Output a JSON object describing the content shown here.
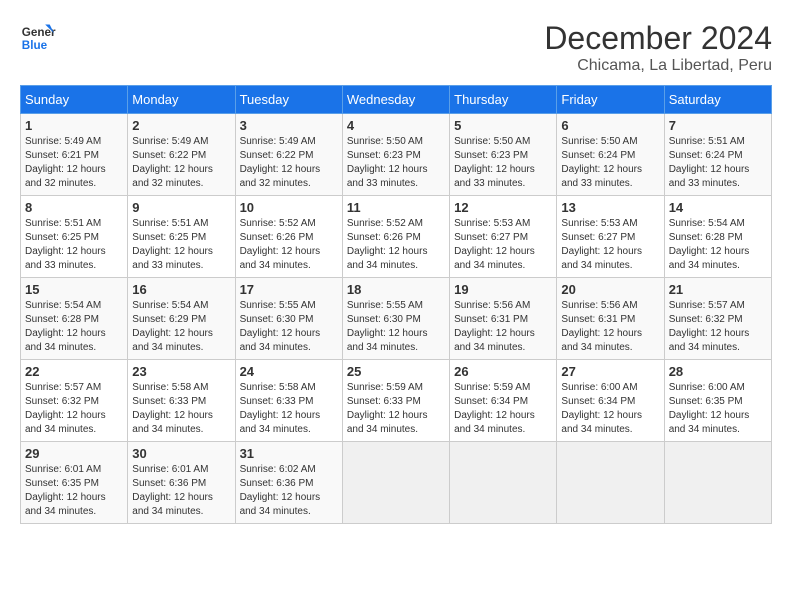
{
  "logo": {
    "line1": "General",
    "line2": "Blue"
  },
  "title": "December 2024",
  "location": "Chicama, La Libertad, Peru",
  "days_header": [
    "Sunday",
    "Monday",
    "Tuesday",
    "Wednesday",
    "Thursday",
    "Friday",
    "Saturday"
  ],
  "weeks": [
    [
      {
        "num": "1",
        "info": "Sunrise: 5:49 AM\nSunset: 6:21 PM\nDaylight: 12 hours\nand 32 minutes."
      },
      {
        "num": "2",
        "info": "Sunrise: 5:49 AM\nSunset: 6:22 PM\nDaylight: 12 hours\nand 32 minutes."
      },
      {
        "num": "3",
        "info": "Sunrise: 5:49 AM\nSunset: 6:22 PM\nDaylight: 12 hours\nand 32 minutes."
      },
      {
        "num": "4",
        "info": "Sunrise: 5:50 AM\nSunset: 6:23 PM\nDaylight: 12 hours\nand 33 minutes."
      },
      {
        "num": "5",
        "info": "Sunrise: 5:50 AM\nSunset: 6:23 PM\nDaylight: 12 hours\nand 33 minutes."
      },
      {
        "num": "6",
        "info": "Sunrise: 5:50 AM\nSunset: 6:24 PM\nDaylight: 12 hours\nand 33 minutes."
      },
      {
        "num": "7",
        "info": "Sunrise: 5:51 AM\nSunset: 6:24 PM\nDaylight: 12 hours\nand 33 minutes."
      }
    ],
    [
      {
        "num": "8",
        "info": "Sunrise: 5:51 AM\nSunset: 6:25 PM\nDaylight: 12 hours\nand 33 minutes."
      },
      {
        "num": "9",
        "info": "Sunrise: 5:51 AM\nSunset: 6:25 PM\nDaylight: 12 hours\nand 33 minutes."
      },
      {
        "num": "10",
        "info": "Sunrise: 5:52 AM\nSunset: 6:26 PM\nDaylight: 12 hours\nand 34 minutes."
      },
      {
        "num": "11",
        "info": "Sunrise: 5:52 AM\nSunset: 6:26 PM\nDaylight: 12 hours\nand 34 minutes."
      },
      {
        "num": "12",
        "info": "Sunrise: 5:53 AM\nSunset: 6:27 PM\nDaylight: 12 hours\nand 34 minutes."
      },
      {
        "num": "13",
        "info": "Sunrise: 5:53 AM\nSunset: 6:27 PM\nDaylight: 12 hours\nand 34 minutes."
      },
      {
        "num": "14",
        "info": "Sunrise: 5:54 AM\nSunset: 6:28 PM\nDaylight: 12 hours\nand 34 minutes."
      }
    ],
    [
      {
        "num": "15",
        "info": "Sunrise: 5:54 AM\nSunset: 6:28 PM\nDaylight: 12 hours\nand 34 minutes."
      },
      {
        "num": "16",
        "info": "Sunrise: 5:54 AM\nSunset: 6:29 PM\nDaylight: 12 hours\nand 34 minutes."
      },
      {
        "num": "17",
        "info": "Sunrise: 5:55 AM\nSunset: 6:30 PM\nDaylight: 12 hours\nand 34 minutes."
      },
      {
        "num": "18",
        "info": "Sunrise: 5:55 AM\nSunset: 6:30 PM\nDaylight: 12 hours\nand 34 minutes."
      },
      {
        "num": "19",
        "info": "Sunrise: 5:56 AM\nSunset: 6:31 PM\nDaylight: 12 hours\nand 34 minutes."
      },
      {
        "num": "20",
        "info": "Sunrise: 5:56 AM\nSunset: 6:31 PM\nDaylight: 12 hours\nand 34 minutes."
      },
      {
        "num": "21",
        "info": "Sunrise: 5:57 AM\nSunset: 6:32 PM\nDaylight: 12 hours\nand 34 minutes."
      }
    ],
    [
      {
        "num": "22",
        "info": "Sunrise: 5:57 AM\nSunset: 6:32 PM\nDaylight: 12 hours\nand 34 minutes."
      },
      {
        "num": "23",
        "info": "Sunrise: 5:58 AM\nSunset: 6:33 PM\nDaylight: 12 hours\nand 34 minutes."
      },
      {
        "num": "24",
        "info": "Sunrise: 5:58 AM\nSunset: 6:33 PM\nDaylight: 12 hours\nand 34 minutes."
      },
      {
        "num": "25",
        "info": "Sunrise: 5:59 AM\nSunset: 6:33 PM\nDaylight: 12 hours\nand 34 minutes."
      },
      {
        "num": "26",
        "info": "Sunrise: 5:59 AM\nSunset: 6:34 PM\nDaylight: 12 hours\nand 34 minutes."
      },
      {
        "num": "27",
        "info": "Sunrise: 6:00 AM\nSunset: 6:34 PM\nDaylight: 12 hours\nand 34 minutes."
      },
      {
        "num": "28",
        "info": "Sunrise: 6:00 AM\nSunset: 6:35 PM\nDaylight: 12 hours\nand 34 minutes."
      }
    ],
    [
      {
        "num": "29",
        "info": "Sunrise: 6:01 AM\nSunset: 6:35 PM\nDaylight: 12 hours\nand 34 minutes."
      },
      {
        "num": "30",
        "info": "Sunrise: 6:01 AM\nSunset: 6:36 PM\nDaylight: 12 hours\nand 34 minutes."
      },
      {
        "num": "31",
        "info": "Sunrise: 6:02 AM\nSunset: 6:36 PM\nDaylight: 12 hours\nand 34 minutes."
      },
      {
        "num": "",
        "info": ""
      },
      {
        "num": "",
        "info": ""
      },
      {
        "num": "",
        "info": ""
      },
      {
        "num": "",
        "info": ""
      }
    ]
  ]
}
